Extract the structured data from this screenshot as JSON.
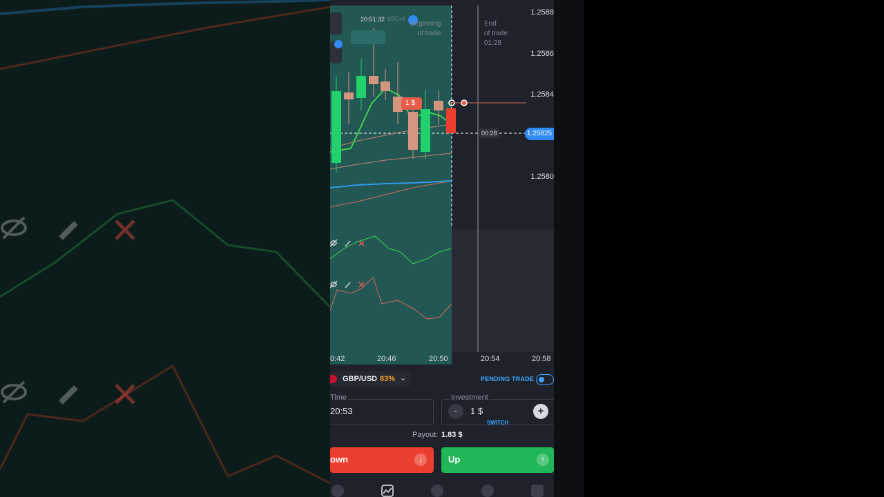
{
  "prices": [
    "1.2588",
    "1.2586",
    "1.2584",
    "1.2582",
    "1.2580"
  ],
  "current_price": "1.25825",
  "countdown": "00:28",
  "clock": "20:51:32",
  "timezone": "UTC+5",
  "annotations": {
    "beginning": [
      "Beginning",
      "of trade"
    ],
    "end": [
      "End",
      "of trade",
      "01:28"
    ]
  },
  "time_axis": [
    "0:42",
    "20:46",
    "20:50",
    "20:54",
    "20:58"
  ],
  "bet_amount": "1 $",
  "asset": {
    "name": "GBP/USD",
    "payout_percent": "83%"
  },
  "pending_trade_label": "PENDING TRADE",
  "time_field": {
    "label": "Time",
    "value": "20:53"
  },
  "investment_field": {
    "label": "Investment",
    "value": "1 $",
    "switch_label": "SWITCH"
  },
  "payout": {
    "label": "Payout:",
    "value": "1.83 $"
  },
  "buttons": {
    "down": "own",
    "up": "Up"
  },
  "chart_data": {
    "type": "candlestick",
    "time_axis": [
      "0:42",
      "20:46",
      "20:50",
      "20:54",
      "20:58"
    ],
    "y_ticks": [
      "1.2588",
      "1.2586",
      "1.2584",
      "1.2582",
      "1.2580"
    ],
    "current_price": 1.25825
  },
  "colors": {
    "up": "#21b657",
    "down": "#ec3e2e",
    "accent": "#3fa3ff",
    "panel": "#1f222b"
  }
}
